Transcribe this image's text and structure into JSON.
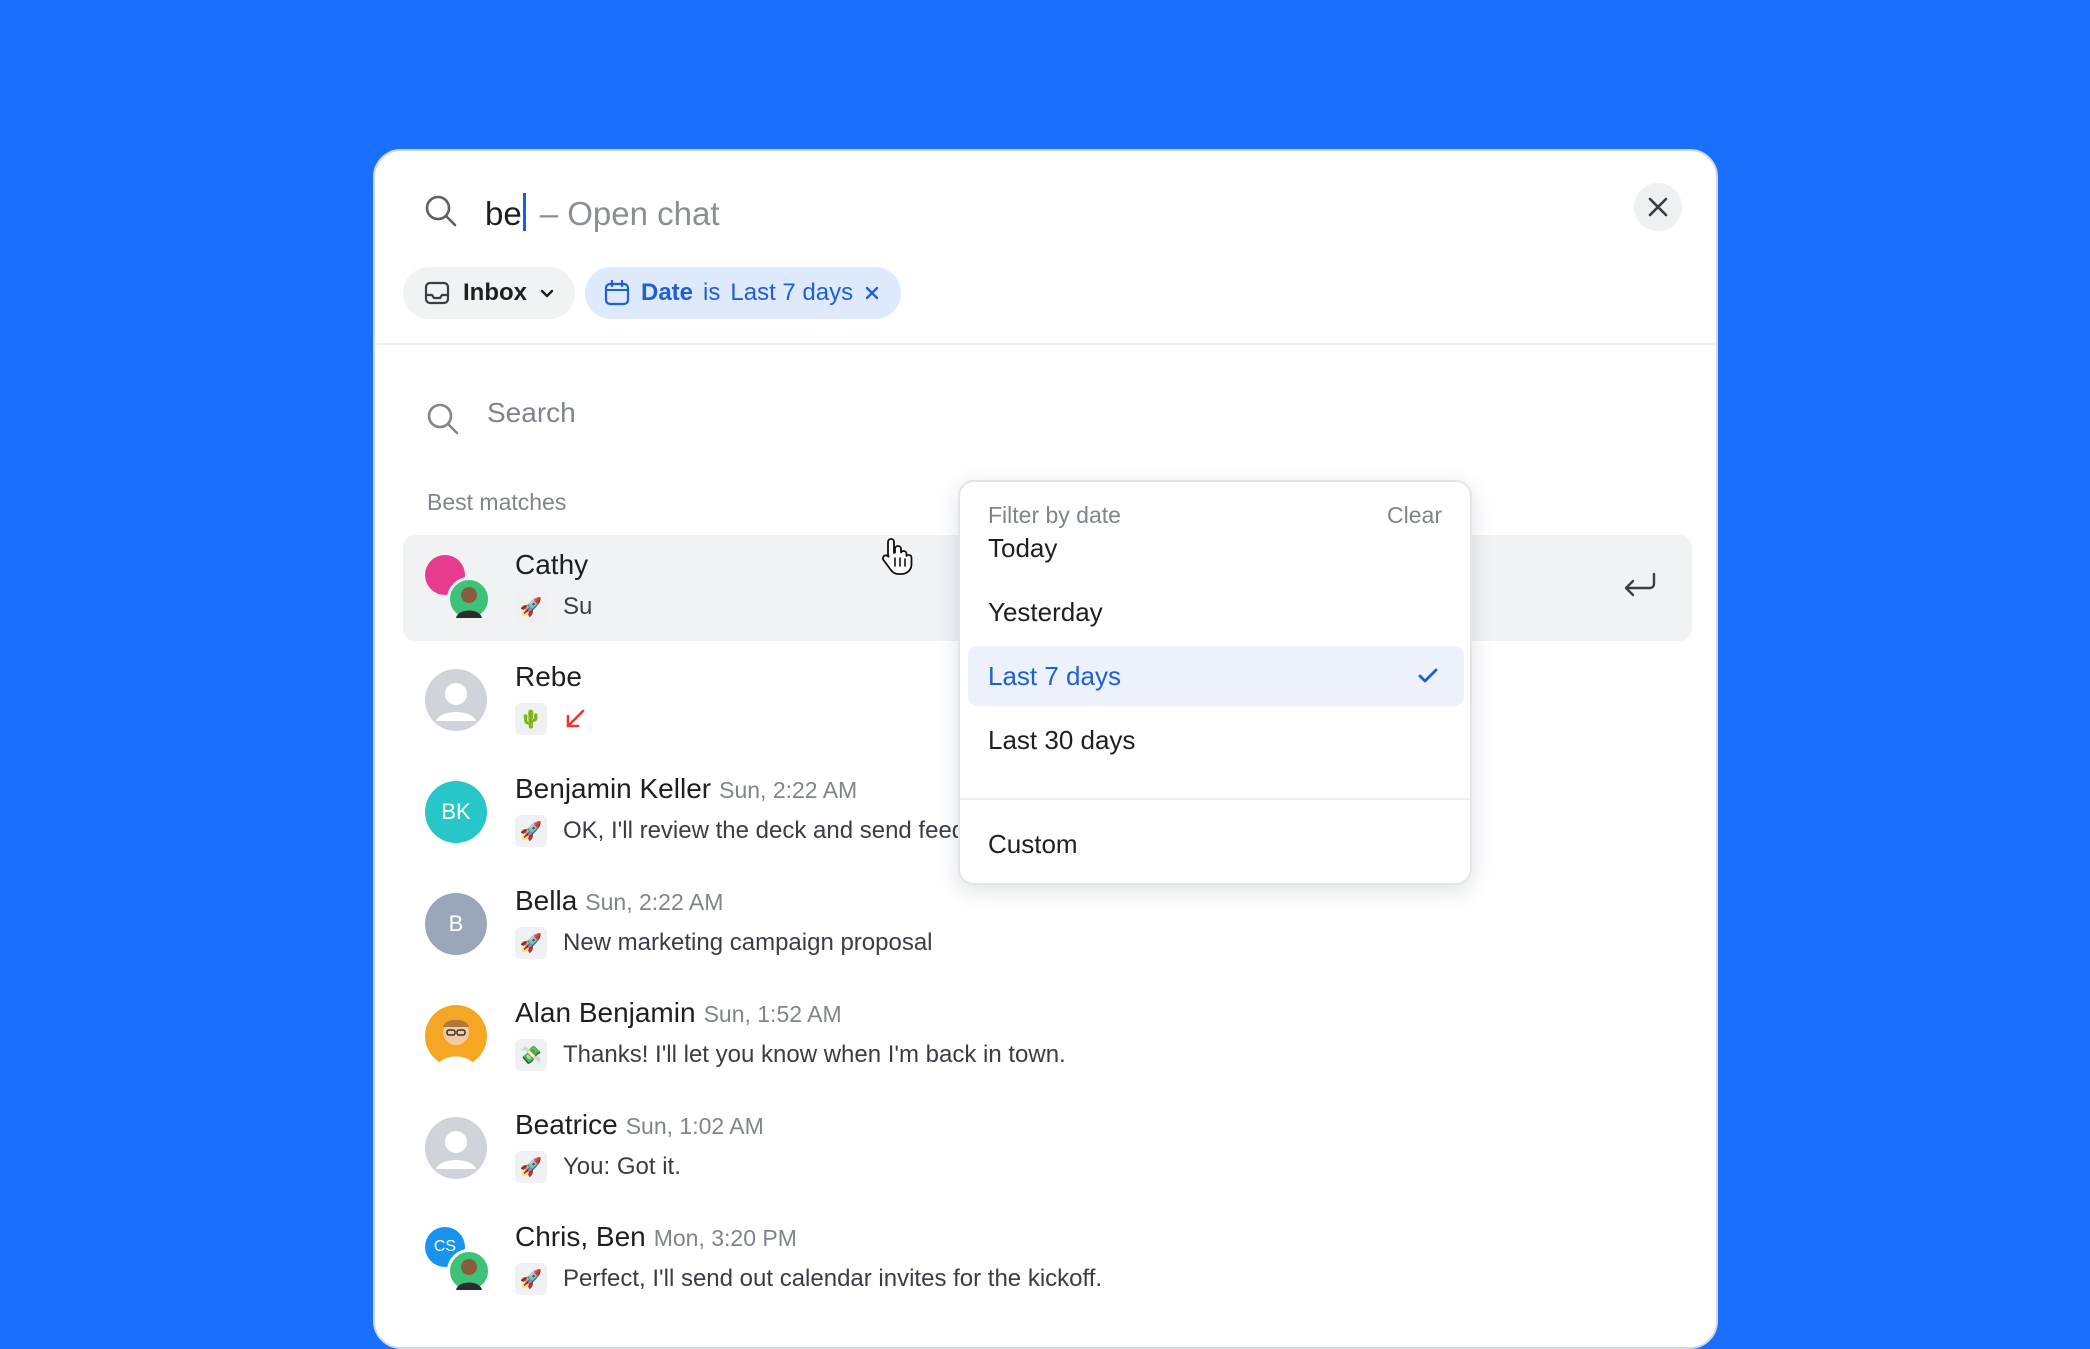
{
  "search": {
    "query": "be",
    "hint": "– Open chat",
    "sub_placeholder": "Search"
  },
  "filters": {
    "inbox_label": "Inbox",
    "date_key": "Date",
    "date_op": "is",
    "date_value": "Last 7 days"
  },
  "section_label": "Best matches",
  "dropdown": {
    "title": "Filter by date",
    "clear_label": "Clear",
    "options": [
      "Today",
      "Yesterday",
      "Last 7 days",
      "Last 30 days"
    ],
    "selected": "Last 7 days",
    "custom_label": "Custom"
  },
  "results": [
    {
      "name": "Cathy",
      "time": "",
      "emoji": "🚀",
      "message": "Su"
    },
    {
      "name": "Rebe",
      "time": "",
      "emoji": "🌵",
      "message": ""
    },
    {
      "name": "Benjamin Keller",
      "time": "Sun, 2:22 AM",
      "emoji": "🚀",
      "message": "OK, I'll review the deck and send feedback by noon.",
      "initials": "BK"
    },
    {
      "name": "Bella",
      "time": "Sun, 2:22 AM",
      "emoji": "🚀",
      "message": "New marketing campaign proposal",
      "initials": "B"
    },
    {
      "name": "Alan Benjamin",
      "time": "Sun, 1:52 AM",
      "emoji": "💸",
      "message": "Thanks! I'll let you know when I'm back in town."
    },
    {
      "name": "Beatrice",
      "time": "Sun, 1:02 AM",
      "emoji": "🚀",
      "message": "You: Got it."
    },
    {
      "name": "Chris, Ben",
      "time": "Mon, 3:20 PM",
      "emoji": "🚀",
      "message": "Perfect, I'll send out calendar invites for the kickoff.",
      "initials": "CS"
    }
  ],
  "colors": {
    "background": "#1b6ffe",
    "accent": "#1d5fd6",
    "selected_bg": "#ecf1fc",
    "bk_avatar": "#26c6c9",
    "b_avatar": "#9aa6ba",
    "cs_avatar": "#1794f0"
  }
}
